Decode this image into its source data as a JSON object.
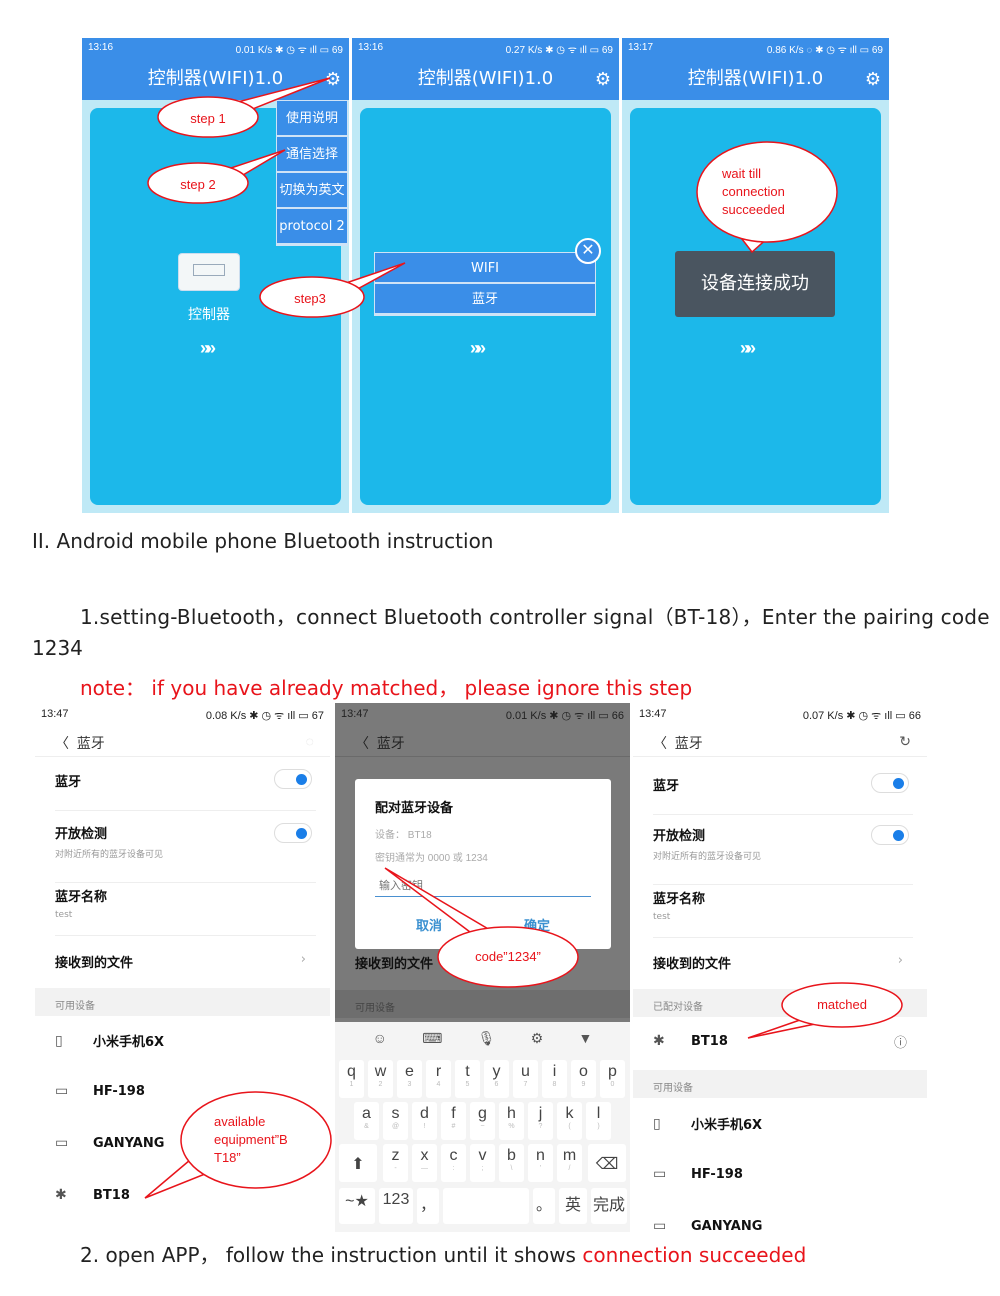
{
  "app_panels": [
    {
      "time": "13:16",
      "speed": "0.01 K/s",
      "battery": "69",
      "title": "控制器(WIFI)1.0",
      "icon": "gear-icon",
      "menu": [
        "使用说明",
        "通信选择",
        "切换为英文",
        "protocol 2"
      ],
      "device_label": "控制器",
      "chevron": "»»",
      "callouts": [
        "step 1",
        "step 2",
        "step3"
      ]
    },
    {
      "time": "13:16",
      "speed": "0.27 K/s",
      "battery": "69",
      "title": "控制器(WIFI)1.0",
      "dialog_options": [
        "WIFI",
        "蓝牙"
      ],
      "chevron": "»»"
    },
    {
      "time": "13:17",
      "speed": "0.86 K/s",
      "battery": "69",
      "title": "控制器(WIFI)1.0",
      "toast": "设备连接成功",
      "chevron": "»»",
      "callout": "wait till connection succeeded"
    }
  ],
  "doc": {
    "heading": "II. Android mobile phone Bluetooth instruction",
    "step1_line1": "1.setting-Bluetooth，connect Bluetooth controller signal（BT-18），Enter the pairing code",
    "step1_line2": "1234",
    "note": "note：  if you have already matched，  please ignore this step",
    "step2_prefix": "2. open APP，  follow the instruction until it shows ",
    "step2_highlight": "connection succeeded"
  },
  "bt_panels": [
    {
      "time": "13:47",
      "speed": "0.08 K/s",
      "battery": "67",
      "header": "蓝牙",
      "rows": {
        "bluetooth": "蓝牙",
        "discover": "开放检测",
        "discover_sub": "对附近所有的蓝牙设备可见",
        "name": "蓝牙名称",
        "name_value": "test",
        "files": "接收到的文件"
      },
      "section": "可用设备",
      "devices": [
        "小米手机6X",
        "HF-198",
        "GANYANG",
        "BT18"
      ],
      "callout": "available equipment”B T18”"
    },
    {
      "time": "13:47",
      "speed": "0.01 K/s",
      "battery": "66",
      "header": "蓝牙",
      "files": "接收到的文件",
      "section": "可用设备",
      "dialog": {
        "title": "配对蓝牙设备",
        "device": "设备：  BT18",
        "hint": "密钥通常为 0000 或 1234",
        "placeholder": "输入密钥",
        "cancel": "取消",
        "ok": "确定"
      },
      "callout": "code”1234”",
      "keyboard": {
        "row1": [
          [
            "q",
            "1"
          ],
          [
            "w",
            "2"
          ],
          [
            "e",
            "3"
          ],
          [
            "r",
            "4"
          ],
          [
            "t",
            "5"
          ],
          [
            "y",
            "6"
          ],
          [
            "u",
            "7"
          ],
          [
            "i",
            "8"
          ],
          [
            "o",
            "9"
          ],
          [
            "p",
            "0"
          ]
        ],
        "row2": [
          [
            "a",
            "&"
          ],
          [
            "s",
            "@"
          ],
          [
            "d",
            "!"
          ],
          [
            "f",
            "#"
          ],
          [
            "g",
            "~"
          ],
          [
            "h",
            "%"
          ],
          [
            "j",
            "?"
          ],
          [
            "k",
            "("
          ],
          [
            "l",
            ")"
          ]
        ],
        "row3": [
          [
            "z",
            "-"
          ],
          [
            "x",
            "—"
          ],
          [
            "c",
            ":"
          ],
          [
            "v",
            ";"
          ],
          [
            "b",
            "\\"
          ],
          [
            "n",
            "'"
          ],
          [
            "m",
            "/"
          ]
        ],
        "bottom": [
          "~★",
          "123",
          "，",
          "",
          "。",
          "英",
          "完成"
        ]
      }
    },
    {
      "time": "13:47",
      "speed": "0.07 K/s",
      "battery": "66",
      "header": "蓝牙",
      "rows": {
        "bluetooth": "蓝牙",
        "discover": "开放检测",
        "discover_sub": "对附近所有的蓝牙设备可见",
        "name": "蓝牙名称",
        "name_value": "test",
        "files": "接收到的文件"
      },
      "paired_section": "已配对设备",
      "paired": "BT18",
      "section": "可用设备",
      "devices": [
        "小米手机6X",
        "HF-198",
        "GANYANG"
      ],
      "callout": "matched"
    }
  ],
  "colors": {
    "app_blue": "#3a8ee8",
    "app_cyan": "#1cb8ea",
    "callout_red": "#e8141b",
    "toggle_blue": "#1a7ee8"
  }
}
